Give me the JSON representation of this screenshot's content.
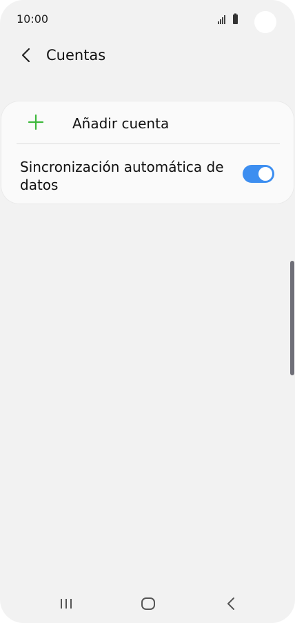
{
  "status_bar": {
    "time": "10:00"
  },
  "header": {
    "title": "Cuentas",
    "back_icon": "chevron-left-icon"
  },
  "accounts_card": {
    "add_account": {
      "icon": "plus-icon",
      "label": "Añadir cuenta",
      "icon_color": "#3cb83a"
    },
    "auto_sync": {
      "label": "Sincronización automática de datos",
      "enabled": true,
      "toggle_color": "#3d8ef0"
    }
  },
  "navigation_bar": {
    "recents_icon": "recents-icon",
    "home_icon": "home-icon",
    "back_icon": "back-icon"
  }
}
